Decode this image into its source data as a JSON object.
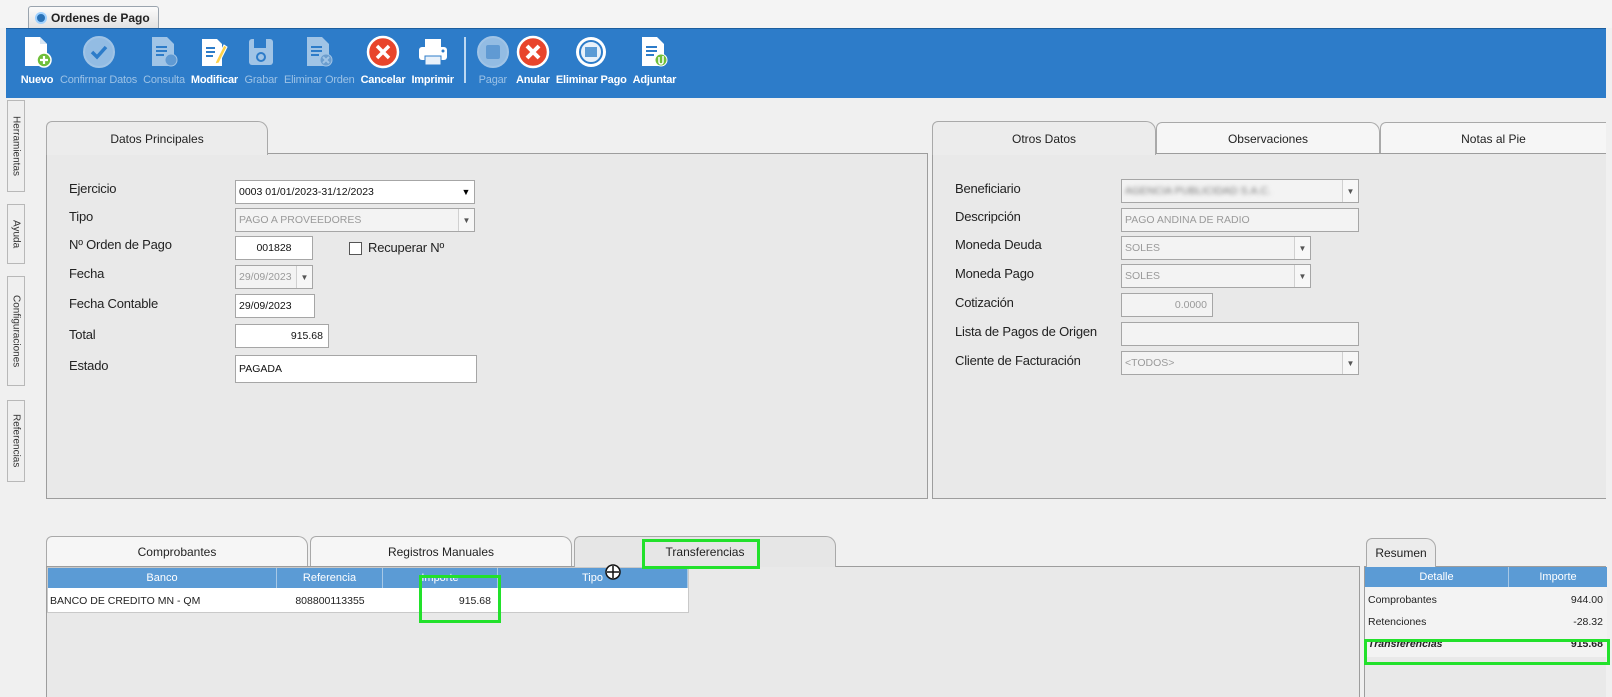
{
  "window": {
    "tab_title": "Ordenes de Pago"
  },
  "toolbar": {
    "buttons": [
      {
        "label": "Nuevo"
      },
      {
        "label": "Confirmar Datos"
      },
      {
        "label": "Consulta"
      },
      {
        "label": "Modificar"
      },
      {
        "label": "Grabar"
      },
      {
        "label": "Eliminar Orden"
      },
      {
        "label": "Cancelar"
      },
      {
        "label": "Imprimir"
      },
      {
        "label": "Pagar"
      },
      {
        "label": "Anular"
      },
      {
        "label": "Eliminar Pago"
      },
      {
        "label": "Adjuntar"
      }
    ]
  },
  "sidetabs": [
    "Herramientas",
    "Ayuda",
    "Configuraciones",
    "Referencias"
  ],
  "principal": {
    "tab": "Datos Principales",
    "fields": {
      "ejercicio": {
        "label": "Ejercicio",
        "value": "0003 01/01/2023-31/12/2023"
      },
      "tipo": {
        "label": "Tipo",
        "value": "PAGO A PROVEEDORES"
      },
      "orden": {
        "label": "Nº Orden de Pago",
        "value": "001828"
      },
      "recuperar": {
        "label": "Recuperar Nº"
      },
      "fecha": {
        "label": "Fecha",
        "value": "29/09/2023"
      },
      "fecha_contable": {
        "label": "Fecha Contable",
        "value": "29/09/2023"
      },
      "total": {
        "label": "Total",
        "value": "915.68"
      },
      "estado": {
        "label": "Estado",
        "value": "PAGADA"
      }
    }
  },
  "otros": {
    "tabs": [
      "Otros Datos",
      "Observaciones",
      "Notas al Pie"
    ],
    "fields": {
      "beneficiario": {
        "label": "Beneficiario",
        "value": "AGENCIA PUBLICIDAD S.A.C."
      },
      "descripcion": {
        "label": "Descripción",
        "value": "PAGO ANDINA DE RADIO"
      },
      "moneda_deuda": {
        "label": "Moneda Deuda",
        "value": "SOLES"
      },
      "moneda_pago": {
        "label": "Moneda Pago",
        "value": "SOLES"
      },
      "cotizacion": {
        "label": "Cotización",
        "value": "0.0000"
      },
      "lista_pagos": {
        "label": "Lista de Pagos de Origen",
        "value": ""
      },
      "cliente": {
        "label": "Cliente de Facturación",
        "value": "<TODOS>"
      }
    }
  },
  "bottom": {
    "tabs": [
      "Comprobantes",
      "Registros Manuales",
      "Transferencias"
    ],
    "grid": {
      "columns": [
        "Banco",
        "Referencia",
        "Importe",
        "Tipo"
      ],
      "rows": [
        {
          "banco": "BANCO DE CREDITO MN - QM",
          "referencia": "808800113355",
          "importe": "915.68",
          "tipo": ""
        }
      ]
    }
  },
  "resumen": {
    "tab": "Resumen",
    "columns": [
      "Detalle",
      "Importe"
    ],
    "rows": [
      {
        "detalle": "Comprobantes",
        "importe": "944.00"
      },
      {
        "detalle": "Retenciones",
        "importe": "-28.32"
      },
      {
        "detalle": "Transferencias",
        "importe": "915.68"
      }
    ]
  },
  "colors": {
    "toolbar": "#2d7cc9",
    "grid_header": "#5b9bd5",
    "highlight": "#22e12b"
  }
}
